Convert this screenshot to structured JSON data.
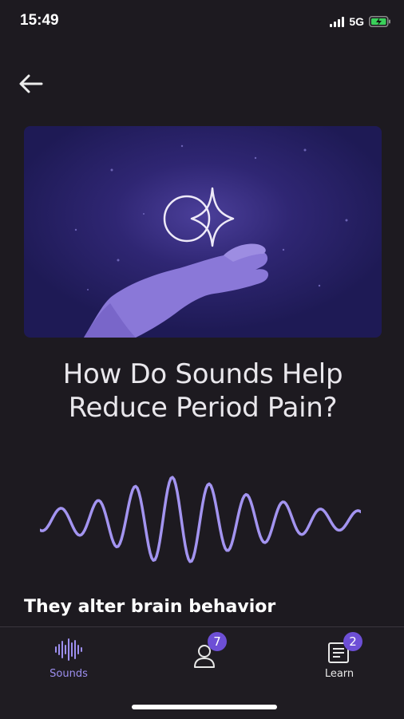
{
  "status": {
    "time": "15:49",
    "network": "5G"
  },
  "header": {
    "back_icon": "arrow-left-icon"
  },
  "article": {
    "title_line1": "How Do Sounds Help",
    "title_line2": "Reduce Period Pain?",
    "section_heading": "They alter brain behavior"
  },
  "tabs": [
    {
      "label": "Sounds",
      "icon": "waveform-icon",
      "active": true
    },
    {
      "label": "",
      "icon": "person-icon",
      "badge": "7"
    },
    {
      "label": "Learn",
      "icon": "newspaper-icon",
      "badge": "2"
    }
  ],
  "colors": {
    "background": "#1d1a20",
    "accent": "#9d8ff0",
    "badge": "#6d4fd6",
    "hero_bg": "#2a2260"
  }
}
